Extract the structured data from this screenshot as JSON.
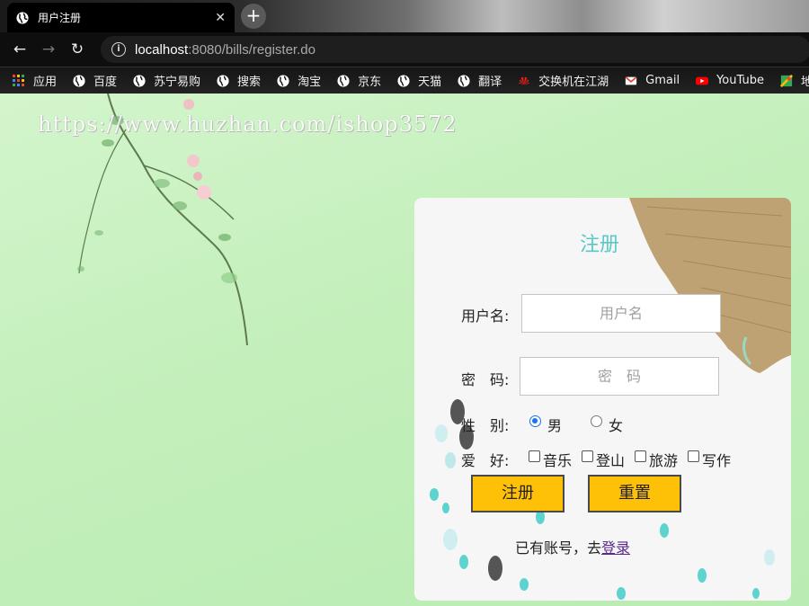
{
  "browser": {
    "tab_title": "用户注册",
    "tab_close": "✕",
    "new_tab": "+",
    "url_host": "localhost",
    "url_rest": ":8080/bills/register.do",
    "bookmarks": [
      "应用",
      "百度",
      "苏宁易购",
      "搜索",
      "淘宝",
      "京东",
      "天猫",
      "翻译",
      "交换机在江湖",
      "Gmail",
      "YouTube",
      "地"
    ]
  },
  "page": {
    "watermark": "https://www.huzhan.com/ishop3572"
  },
  "form": {
    "title": "注册",
    "username_label": "用户名:",
    "username_placeholder": "用户名",
    "password_label": "密　码:",
    "password_placeholder": "密　码",
    "gender_label": "性　别:",
    "gender_options": [
      "男",
      "女"
    ],
    "gender_selected": "男",
    "hobby_label": "爱　好:",
    "hobby_options": [
      "音乐",
      "登山",
      "旅游",
      "写作"
    ],
    "register_button": "注册",
    "reset_button": "重置",
    "login_prompt": "已有账号，去",
    "login_link": "登录"
  },
  "colors": {
    "title": "#5ac8c8",
    "button": "#ffc107",
    "radio_selected": "#1a73e8",
    "link": "#5b2a8c"
  }
}
